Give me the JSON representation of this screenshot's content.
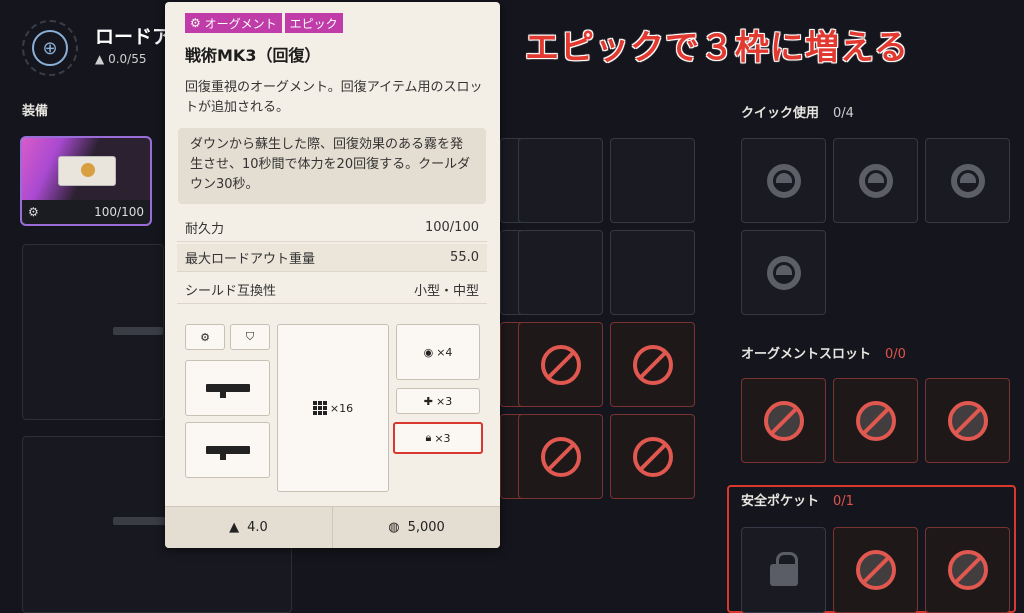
{
  "header": {
    "title": "ロードア",
    "weight": "0.0/55"
  },
  "equipment": {
    "label": "装備",
    "durability": "100/100"
  },
  "quick_use": {
    "label": "クイック使用",
    "count": "0/4"
  },
  "augment_slots": {
    "label": "オーグメントスロット",
    "count": "0/0"
  },
  "safe_pocket": {
    "label": "安全ポケット",
    "count": "0/1"
  },
  "headline": "エピックで３枠に増える",
  "tooltip": {
    "tags": [
      "オーグメント",
      "エピック"
    ],
    "title": "戦術MK3（回復）",
    "description": "回復重視のオーグメント。回復アイテム用のスロットが追加される。",
    "effect": "ダウンから蘇生した際、回復効果のある霧を発生させ、10秒間で体力を20回復する。クールダウン30秒。",
    "stats": [
      {
        "label": "耐久力",
        "value": "100/100"
      },
      {
        "label": "最大ロードアウト重量",
        "value": "55.0"
      },
      {
        "label": "シールド互換性",
        "value": "小型・中型"
      }
    ],
    "slots": {
      "backpack": "×16",
      "quick": "×4",
      "medical": "×3",
      "safe": "×3"
    },
    "weight": "4.0",
    "price": "5,000"
  },
  "colors": {
    "accent_red": "#e0584f",
    "epic_pink": "#c03ca8",
    "highlight": "#d9382e"
  }
}
